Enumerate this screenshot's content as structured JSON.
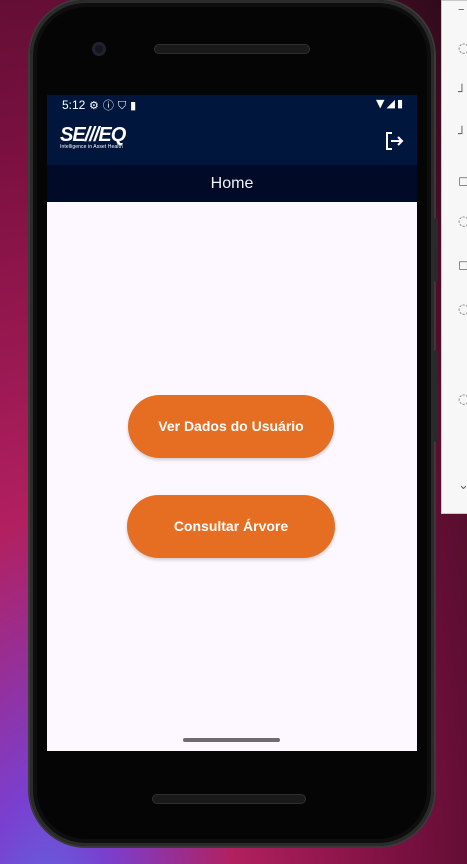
{
  "status_bar": {
    "time": "5:12",
    "left_icons": [
      "settings-icon",
      "info-icon",
      "shield-icon",
      "sd-card-icon"
    ],
    "right_icons": [
      "wifi-icon",
      "signal-icon",
      "battery-icon"
    ]
  },
  "app_bar": {
    "logo_text": "SE///EQ",
    "logo_tagline": "Intelligence in Asset Health",
    "logout_icon": "logout-icon"
  },
  "page": {
    "title": "Home"
  },
  "actions": {
    "view_user_data_label": "Ver Dados do Usuário",
    "consult_tree_label": "Consultar Árvore"
  },
  "colors": {
    "app_bar": "#00163d",
    "title_bar": "#010a26",
    "button": "#e66e22",
    "screen_background": "#fdf7ff"
  }
}
